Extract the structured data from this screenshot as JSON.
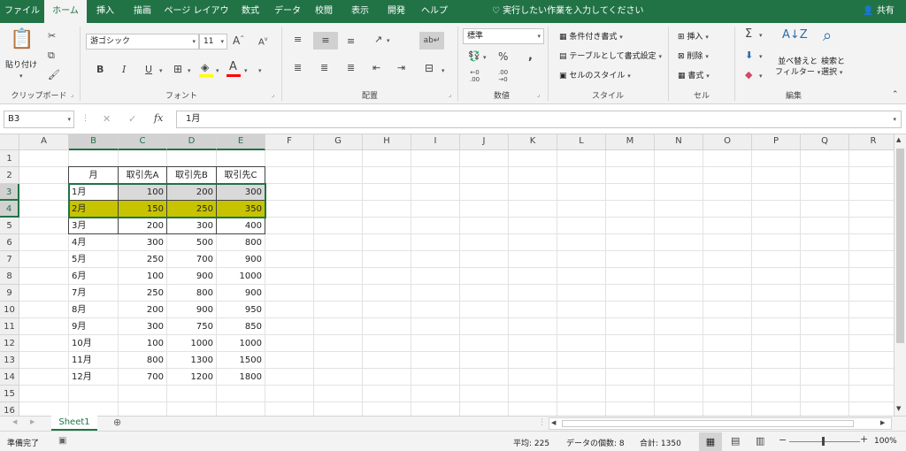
{
  "tabs": [
    "ファイル",
    "ホーム",
    "挿入",
    "描画",
    "ページ レイアウト",
    "数式",
    "データ",
    "校閲",
    "表示",
    "開発",
    "ヘルプ"
  ],
  "tell_me": "実行したい作業を入力してください",
  "share": "共有",
  "ribbon": {
    "clipboard": {
      "paste": "貼り付け",
      "label": "クリップボード"
    },
    "font": {
      "name": "游ゴシック",
      "size": "11",
      "label": "フォント",
      "bold": "B",
      "italic": "I",
      "underline": "U",
      "font_color_glyph": "A",
      "fill_color": "#ffff00",
      "font_color": "#ff0000"
    },
    "alignment": {
      "label": "配置"
    },
    "number": {
      "format": "標準",
      "label": "数値",
      "percent": "%",
      "comma": ","
    },
    "styles": {
      "conditional": "条件付き書式",
      "table": "テーブルとして書式設定",
      "cell_styles": "セルのスタイル",
      "label": "スタイル"
    },
    "cells": {
      "insert": "挿入",
      "delete": "削除",
      "format": "書式",
      "label": "セル"
    },
    "editing": {
      "sort_line1": "並べ替えと",
      "sort_line2": "フィルター",
      "find_line1": "検索と",
      "find_line2": "選択",
      "label": "編集",
      "sigma": "Σ"
    }
  },
  "formula_bar": {
    "name_box": "B3",
    "fx": "fx",
    "value": "1月"
  },
  "grid": {
    "columns": [
      "A",
      "B",
      "C",
      "D",
      "E",
      "F",
      "G",
      "H",
      "I",
      "J",
      "K",
      "L",
      "M",
      "N",
      "O",
      "P",
      "Q",
      "R"
    ],
    "rows": [
      "1",
      "2",
      "3",
      "4",
      "5",
      "6",
      "7",
      "8",
      "9",
      "10",
      "11",
      "12",
      "13",
      "14",
      "15",
      "16"
    ],
    "selected_columns": [
      "B",
      "C",
      "D",
      "E"
    ],
    "selected_rows": [
      "3",
      "4"
    ],
    "highlight_color": "#c7c300",
    "table": {
      "header": [
        "月",
        "取引先A",
        "取引先B",
        "取引先C"
      ],
      "rows": [
        [
          "1月",
          "100",
          "200",
          "300"
        ],
        [
          "2月",
          "150",
          "250",
          "350"
        ],
        [
          "3月",
          "200",
          "300",
          "400"
        ],
        [
          "4月",
          "300",
          "500",
          "800"
        ],
        [
          "5月",
          "250",
          "700",
          "900"
        ],
        [
          "6月",
          "100",
          "900",
          "1000"
        ],
        [
          "7月",
          "250",
          "800",
          "900"
        ],
        [
          "8月",
          "200",
          "900",
          "950"
        ],
        [
          "9月",
          "300",
          "750",
          "850"
        ],
        [
          "10月",
          "100",
          "1000",
          "1000"
        ],
        [
          "11月",
          "800",
          "1300",
          "1500"
        ],
        [
          "12月",
          "700",
          "1200",
          "1800"
        ]
      ]
    }
  },
  "sheet_tabs": [
    "Sheet1"
  ],
  "status": {
    "ready": "準備完了",
    "average": "平均: 225",
    "count": "データの個数: 8",
    "sum": "合計: 1350",
    "zoom": "100%"
  }
}
